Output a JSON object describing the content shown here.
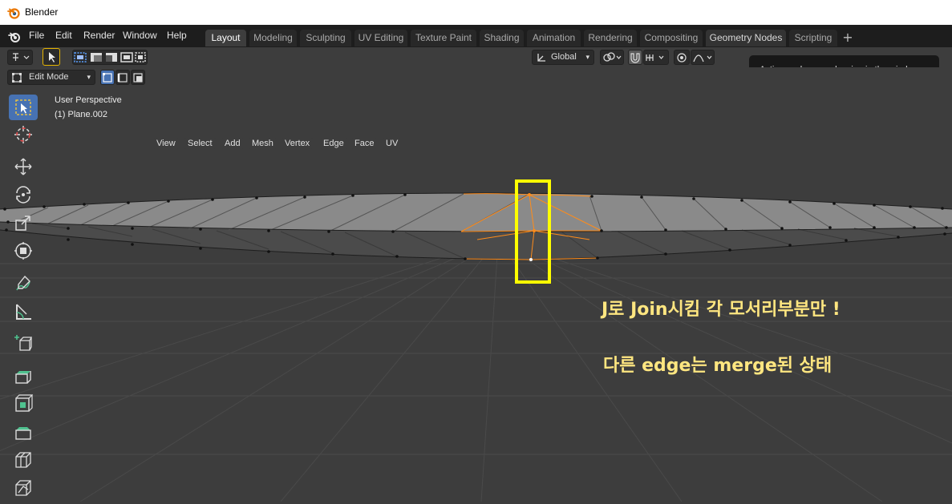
{
  "window": {
    "title": "Blender"
  },
  "menu": [
    "File",
    "Edit",
    "Render",
    "Window",
    "Help"
  ],
  "workspace_tabs": [
    "Layout",
    "Modeling",
    "Sculpting",
    "UV Editing",
    "Texture Paint",
    "Shading",
    "Animation",
    "Rendering",
    "Compositing",
    "Geometry Nodes",
    "Scripting"
  ],
  "active_tab": "Layout",
  "hovered_tab": "Geometry Nodes",
  "header": {
    "orientation": "Global",
    "mode": "Edit Mode",
    "menus": [
      "View",
      "Select",
      "Add",
      "Mesh",
      "Vertex",
      "Edge",
      "Face",
      "UV"
    ]
  },
  "tooltip": "Active workspace showing in the window.",
  "viewport": {
    "perspective": "User Perspective",
    "object": "(1) Plane.002"
  },
  "annotations": {
    "line1": "J로 Join시킴 각 모서리부분만 !",
    "line2": "다른 edge는 merge된 상태"
  },
  "colors": {
    "accent": "#4772b3",
    "highlight_box": "#ffff00",
    "annotation_text": "#ffe680",
    "selection": "#ff8c1a"
  },
  "tools": [
    "select-box",
    "cursor",
    "move",
    "rotate",
    "scale",
    "transform",
    "annotate",
    "measure",
    "add-cube",
    "extrude",
    "inset",
    "bevel",
    "loop-cut",
    "knife"
  ]
}
